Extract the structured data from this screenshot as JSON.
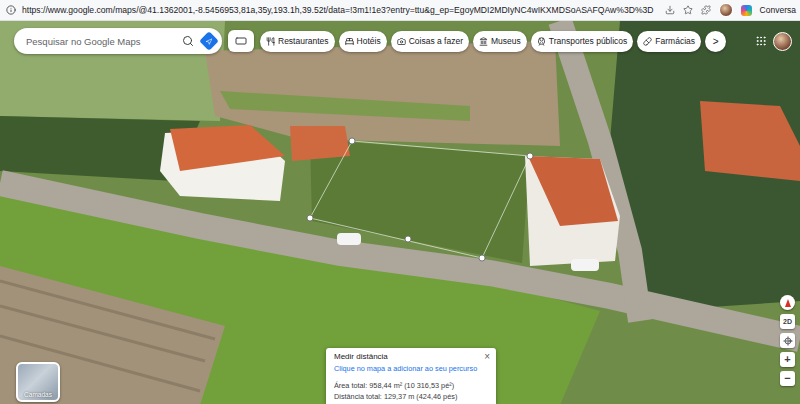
{
  "browser": {
    "url": "https://www.google.com/maps/@41.1362001,-8.5456953,81a,35y,193.1h,39.52t/data=!3m1!1e3?entry=ttu&g_ep=EgoyMDI2MDIyNC4wIKXMDSoASAFQAw%3D%3D",
    "side_label": "Conversa"
  },
  "search": {
    "placeholder": "Pesquisar no Google Maps"
  },
  "chips": [
    {
      "label": "Restaurantes"
    },
    {
      "label": "Hotéis"
    },
    {
      "label": "Coisas a fazer"
    },
    {
      "label": "Museus"
    },
    {
      "label": "Transportes públicos"
    },
    {
      "label": "Farmácias"
    }
  ],
  "chips_more": ">",
  "layers": {
    "label": "Camadas"
  },
  "measure": {
    "title": "Medir distância",
    "close": "×",
    "hint": "Clique no mapa a adicionar ao seu percurso",
    "area": "Área total: 958,44 m² (10 316,53 pé²)",
    "distance": "Distância total: 129,37 m (424,46 pés)"
  },
  "map_controls": {
    "view": "2D",
    "zoom_in": "+",
    "zoom_out": "−"
  }
}
